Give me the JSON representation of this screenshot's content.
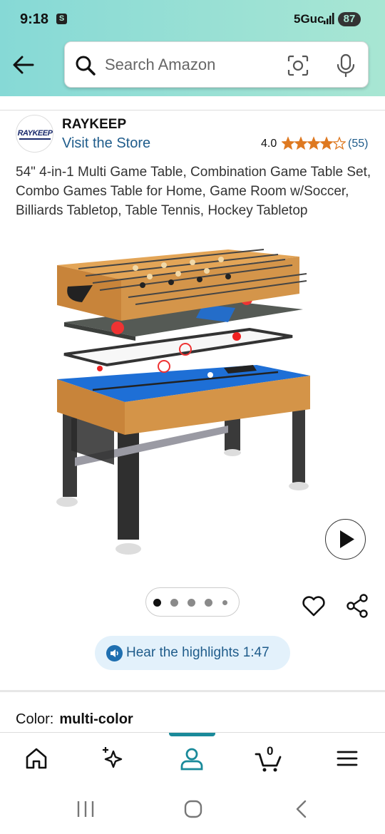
{
  "status_bar": {
    "time": "9:18",
    "app_badge": "S",
    "network": "5Guc",
    "battery": "87"
  },
  "search": {
    "placeholder": "Search Amazon"
  },
  "store": {
    "brand": "RAYKEEP",
    "logo_text": "RAYKEEP",
    "visit_label": "Visit the Store",
    "rating": "4.0",
    "stars": 4.0,
    "review_count": "(55)"
  },
  "product": {
    "title": "54\" 4-in-1 Multi Game Table, Combination Game Table Set, Combo Games Table for Home, Game Room w/Soccer, Billiards Tabletop, Table Tennis, Hockey Tabletop",
    "image_count": 5,
    "active_image": 1
  },
  "audio": {
    "label": "Hear the highlights 1:47"
  },
  "color": {
    "label": "Color:",
    "value": "multi-color"
  },
  "bottom_nav": {
    "cart_count": "0"
  },
  "colors": {
    "header": "#a8e6d3",
    "link": "#1f5c8b",
    "star": "#de7921",
    "accent": "#1a8a9a"
  }
}
